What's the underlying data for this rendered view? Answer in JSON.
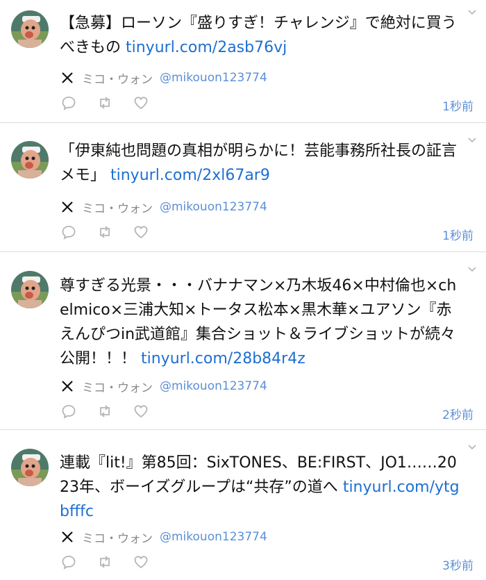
{
  "posts": [
    {
      "text": "【急募】ローソン『盛りすぎ！チャレンジ』で絶対に買うべきもの ",
      "link": "tinyurl.com/2asb76vj",
      "author_name": "ミコ・ウォン",
      "author_handle": "@mikouon123774",
      "time": "1秒前"
    },
    {
      "text": "「伊東純也問題の真相が明らかに！芸能事務所社長の証言メモ」 ",
      "link": "tinyurl.com/2xl67ar9",
      "author_name": "ミコ・ウォン",
      "author_handle": "@mikouon123774",
      "time": "1秒前"
    },
    {
      "text": "尊すぎる光景・・・バナナマン×乃木坂46×中村倫也×chelmico×三浦大知×トータス松本×黒木華×ユアソン『赤えんぴつin武道館』集合ショット＆ライブショットが続々公開！！！ ",
      "link": "tinyurl.com/28b84r4z",
      "author_name": "ミコ・ウォン",
      "author_handle": "@mikouon123774",
      "time": "2秒前"
    },
    {
      "text": "連載『lit!』第85回：SixTONES、BE:FIRST、JO1……2023年、ボーイズグループは“共存”の道へ ",
      "link": "tinyurl.com/ytgbfffc",
      "author_name": "ミコ・ウォン",
      "author_handle": "@mikouon123774",
      "time": "3秒前"
    }
  ],
  "colors": {
    "link": "#1d6fd1",
    "handle": "#5b8fd6",
    "author_name": "#8a8a8a",
    "icon": "#b5b5b5",
    "divider": "#dcdcdc"
  },
  "icons": {
    "platform": "x-logo-icon",
    "actions": [
      "reply-icon",
      "retweet-icon",
      "like-icon"
    ],
    "menu": "chevron-down-icon"
  }
}
